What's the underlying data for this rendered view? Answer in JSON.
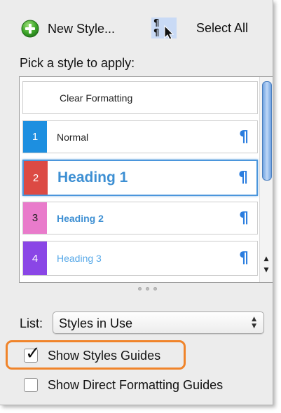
{
  "toolbar": {
    "new_style_label": "New Style...",
    "select_all_label": "Select All",
    "new_style_icon": "plus-circle-icon",
    "select_icon": "pilcrow-cursor-icon"
  },
  "pick_label": "Pick a style to apply:",
  "styles": [
    {
      "number": "",
      "name": "Clear Formatting",
      "color": ""
    },
    {
      "number": "1",
      "name": "Normal",
      "color": "#1d8fe0",
      "mark": "¶"
    },
    {
      "number": "2",
      "name": "Heading 1",
      "color": "#dc4a44",
      "mark": "¶",
      "selected": true
    },
    {
      "number": "3",
      "name": "Heading 2",
      "color": "#e97bcb",
      "mark": "¶"
    },
    {
      "number": "4",
      "name": "Heading 3",
      "color": "#8a46e6",
      "mark": "¶"
    }
  ],
  "list": {
    "label": "List:",
    "value": "Styles in Use"
  },
  "options": {
    "show_styles_guides": {
      "label": "Show Styles Guides",
      "checked": true
    },
    "show_direct_formatting_guides": {
      "label": "Show Direct Formatting Guides",
      "checked": false
    }
  },
  "colors": {
    "accent": "#2a7ddf",
    "highlight": "#f0842a",
    "heading_text": "#3d8fd3"
  }
}
